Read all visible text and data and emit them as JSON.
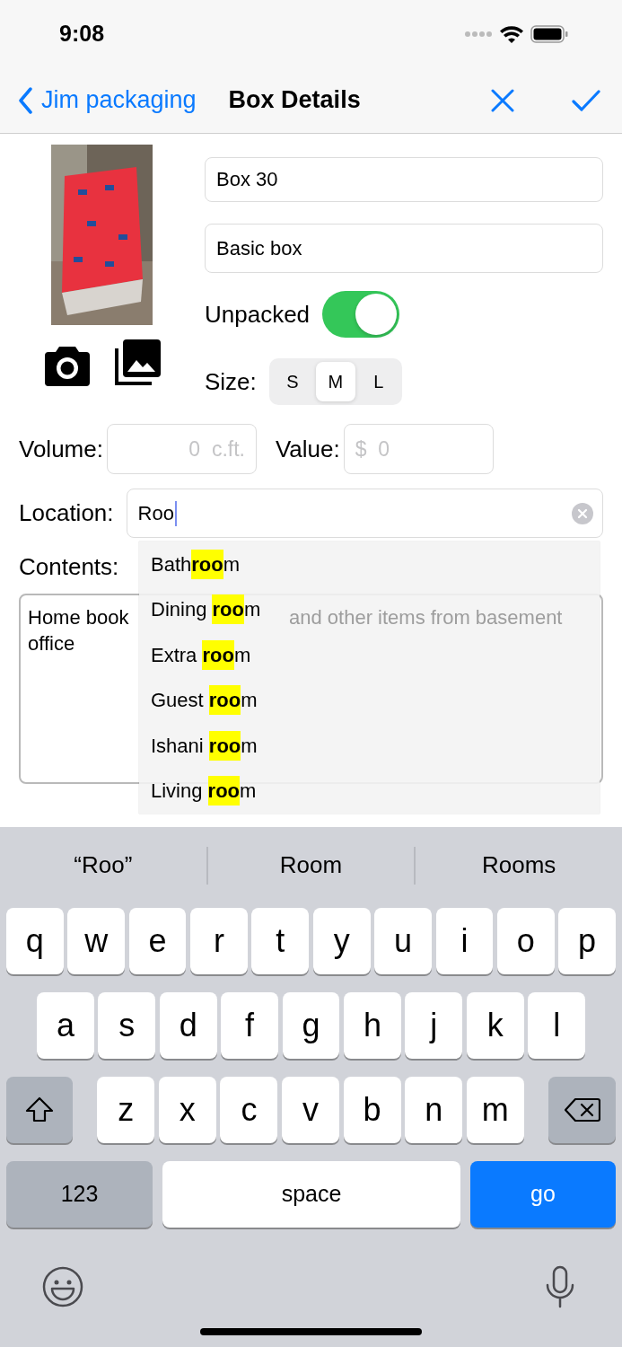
{
  "status_bar": {
    "time": "9:08"
  },
  "nav": {
    "back": "Jim packaging",
    "title": "Box Details"
  },
  "name_field": {
    "value": "Box 30"
  },
  "type_field": {
    "value": "Basic box"
  },
  "unpacked": {
    "label": "Unpacked",
    "on": true
  },
  "size": {
    "label": "Size:",
    "options": [
      {
        "label": "S",
        "selected": false
      },
      {
        "label": "M",
        "selected": true
      },
      {
        "label": "L",
        "selected": false
      }
    ]
  },
  "volume": {
    "label": "Volume:",
    "placeholder": "0  c.ft."
  },
  "value": {
    "label": "Value:",
    "placeholder": "$  0"
  },
  "location": {
    "label": "Location:",
    "value": "Roo"
  },
  "contents": {
    "label": "Contents:",
    "pieces": [
      {
        "text": "Home book",
        "covered": false
      },
      {
        "text": "and other items from basement",
        "covered": true
      },
      {
        "text": "office",
        "covered": false
      }
    ]
  },
  "suggestions": [
    {
      "before": "Bath",
      "match": "roo",
      "after": "m"
    },
    {
      "before": "Dining ",
      "match": "roo",
      "after": "m"
    },
    {
      "before": "Extra ",
      "match": "roo",
      "after": "m"
    },
    {
      "before": "Guest ",
      "match": "roo",
      "after": "m"
    },
    {
      "before": "Ishani ",
      "match": "roo",
      "after": "m"
    },
    {
      "before": "Living ",
      "match": "roo",
      "after": "m"
    }
  ],
  "keyboard": {
    "predictions": [
      "“Roo”",
      "Room",
      "Rooms"
    ],
    "rows": [
      [
        "q",
        "w",
        "e",
        "r",
        "t",
        "y",
        "u",
        "i",
        "o",
        "p"
      ],
      [
        "a",
        "s",
        "d",
        "f",
        "g",
        "h",
        "j",
        "k",
        "l"
      ],
      [
        "z",
        "x",
        "c",
        "v",
        "b",
        "n",
        "m"
      ]
    ],
    "numbers_key": "123",
    "space_key": "space",
    "return_key": "go"
  }
}
